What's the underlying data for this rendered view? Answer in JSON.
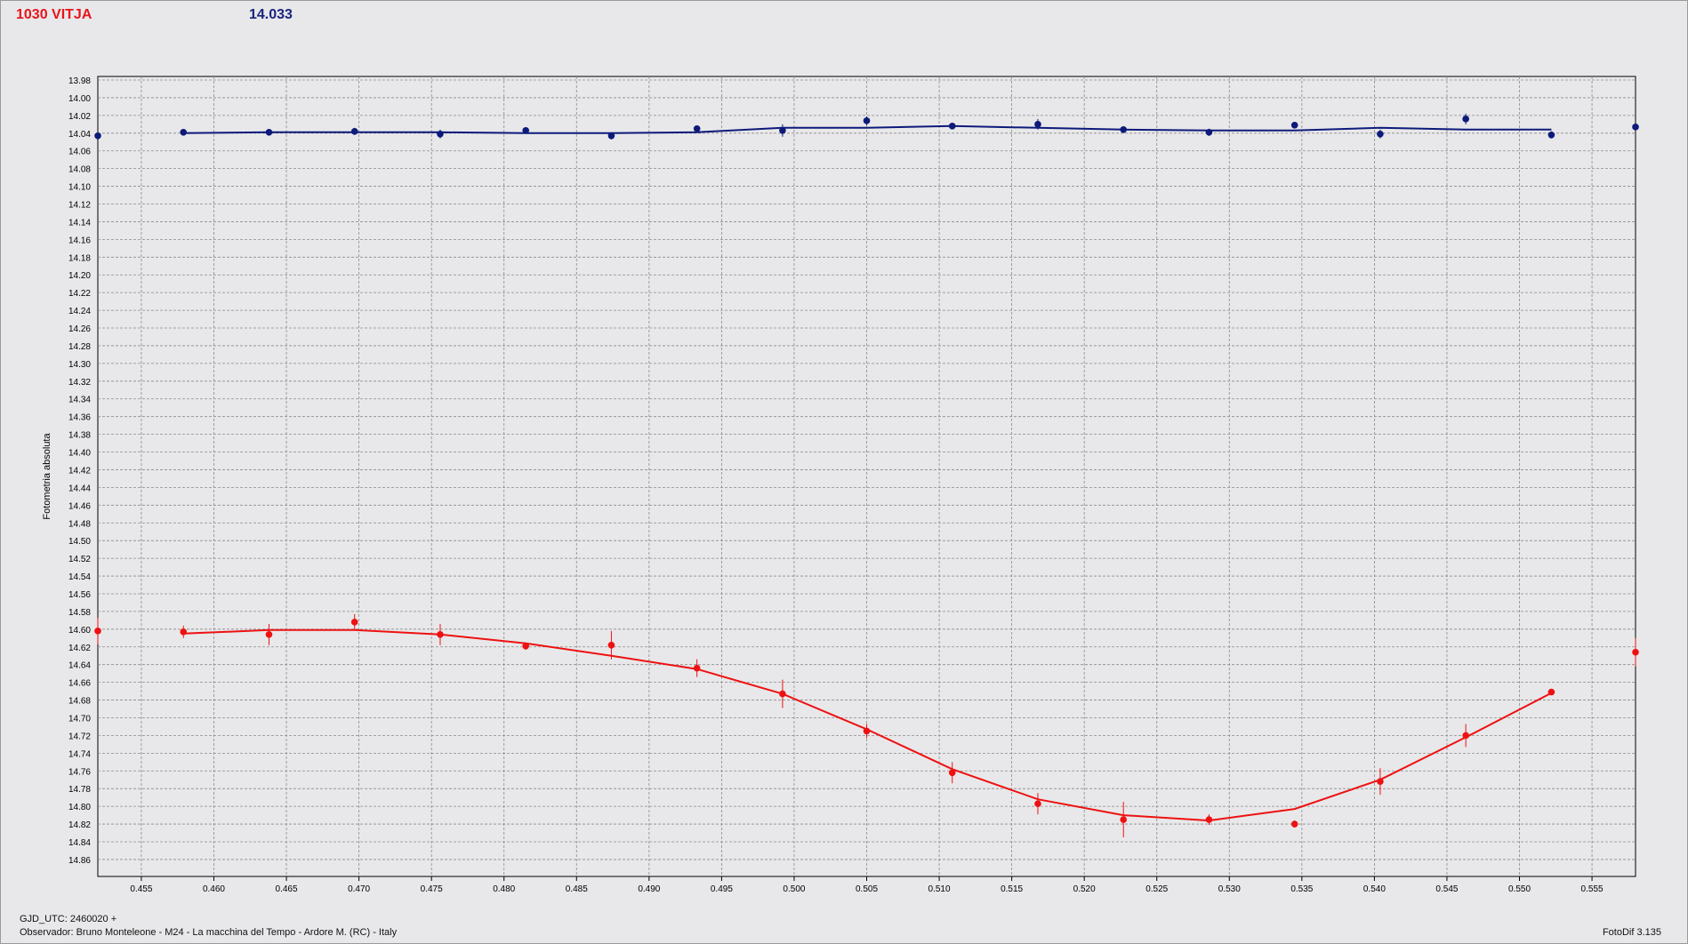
{
  "header": {
    "object_name": "1030 VITJA",
    "magnitude": "14.033"
  },
  "footer": {
    "gjd": "GJD_UTC: 2460020 +",
    "observer": "Observador: Bruno Monteleone - M24 - La macchina del Tempo - Ardore M. (RC) - Italy",
    "software": "FotoDif 3.135"
  },
  "colors": {
    "target": "#ee1111",
    "comparison": "#0d1a7a",
    "grid": "#8a8a8a",
    "background": "#e8e8ea"
  },
  "chart_data": {
    "type": "scatter",
    "ylabel": "Fotometria absoluta",
    "xlabel": "",
    "xlim": [
      0.452,
      0.558
    ],
    "ylim": [
      13.98,
      14.87
    ],
    "y_inverted": true,
    "grid": true,
    "x_ticks": [
      "0.455",
      "0.460",
      "0.465",
      "0.470",
      "0.475",
      "0.480",
      "0.485",
      "0.490",
      "0.495",
      "0.500",
      "0.505",
      "0.510",
      "0.515",
      "0.520",
      "0.525",
      "0.530",
      "0.535",
      "0.540",
      "0.545",
      "0.550",
      "0.555"
    ],
    "y_ticks": [
      "13.98",
      "14.00",
      "14.02",
      "14.04",
      "14.06",
      "14.08",
      "14.10",
      "14.12",
      "14.14",
      "14.16",
      "14.18",
      "14.20",
      "14.22",
      "14.24",
      "14.26",
      "14.28",
      "14.30",
      "14.32",
      "14.34",
      "14.36",
      "14.38",
      "14.40",
      "14.42",
      "14.44",
      "14.46",
      "14.48",
      "14.50",
      "14.52",
      "14.54",
      "14.56",
      "14.58",
      "14.60",
      "14.62",
      "14.64",
      "14.66",
      "14.68",
      "14.70",
      "14.72",
      "14.74",
      "14.76",
      "14.78",
      "14.80",
      "14.82",
      "14.84",
      "14.86"
    ],
    "series": [
      {
        "color": "#0d1a7a",
        "x": [
          0.452,
          0.4579,
          0.4638,
          0.4697,
          0.4756,
          0.4815,
          0.4874,
          0.4933,
          0.4992,
          0.505,
          0.5109,
          0.5168,
          0.5227,
          0.5286,
          0.5345,
          0.5404,
          0.5463,
          0.5522,
          0.558
        ],
        "y": [
          14.043,
          14.039,
          14.039,
          14.038,
          14.041,
          14.037,
          14.043,
          14.035,
          14.037,
          14.026,
          14.032,
          14.03,
          14.036,
          14.039,
          14.031,
          14.041,
          14.024,
          14.042,
          14.033
        ],
        "err": [
          0.002,
          0.003,
          0.003,
          0.004,
          0.005,
          0.003,
          0.004,
          0.003,
          0.007,
          0.005,
          0.003,
          0.006,
          0.003,
          0.004,
          0.003,
          0.005,
          0.006,
          0.004,
          0.003
        ],
        "fit_x": [
          0.4579,
          0.4638,
          0.4697,
          0.4756,
          0.4815,
          0.4874,
          0.4933,
          0.4992,
          0.505,
          0.5109,
          0.5168,
          0.5227,
          0.5286,
          0.5345,
          0.5404,
          0.5463,
          0.5522
        ],
        "fit_y": [
          14.04,
          14.039,
          14.039,
          14.039,
          14.04,
          14.04,
          14.039,
          14.034,
          14.034,
          14.032,
          14.034,
          14.036,
          14.037,
          14.037,
          14.034,
          14.036,
          14.036
        ]
      },
      {
        "color": "#ee1111",
        "x": [
          0.452,
          0.4579,
          0.4638,
          0.4697,
          0.4756,
          0.4815,
          0.4874,
          0.4933,
          0.4992,
          0.505,
          0.5109,
          0.5168,
          0.5227,
          0.5286,
          0.5345,
          0.5404,
          0.5463,
          0.5522,
          0.558
        ],
        "y": [
          14.602,
          14.603,
          14.606,
          14.592,
          14.606,
          14.619,
          14.618,
          14.644,
          14.673,
          14.715,
          14.762,
          14.797,
          14.815,
          14.815,
          14.82,
          14.772,
          14.72,
          14.671,
          14.626
        ],
        "err": [
          0.015,
          0.007,
          0.012,
          0.009,
          0.012,
          0.004,
          0.016,
          0.01,
          0.016,
          0.008,
          0.012,
          0.012,
          0.02,
          0.006,
          0.004,
          0.015,
          0.013,
          0.003,
          0.016
        ],
        "fit_x": [
          0.4579,
          0.4638,
          0.4697,
          0.4756,
          0.4815,
          0.4874,
          0.4933,
          0.4992,
          0.505,
          0.5109,
          0.5168,
          0.5227,
          0.5286,
          0.5345,
          0.5404,
          0.5463,
          0.5522
        ],
        "fit_y": [
          14.605,
          14.601,
          14.601,
          14.606,
          14.616,
          14.63,
          14.645,
          14.673,
          14.713,
          14.758,
          14.792,
          14.81,
          14.816,
          14.803,
          14.77,
          14.722,
          14.672
        ]
      }
    ]
  }
}
